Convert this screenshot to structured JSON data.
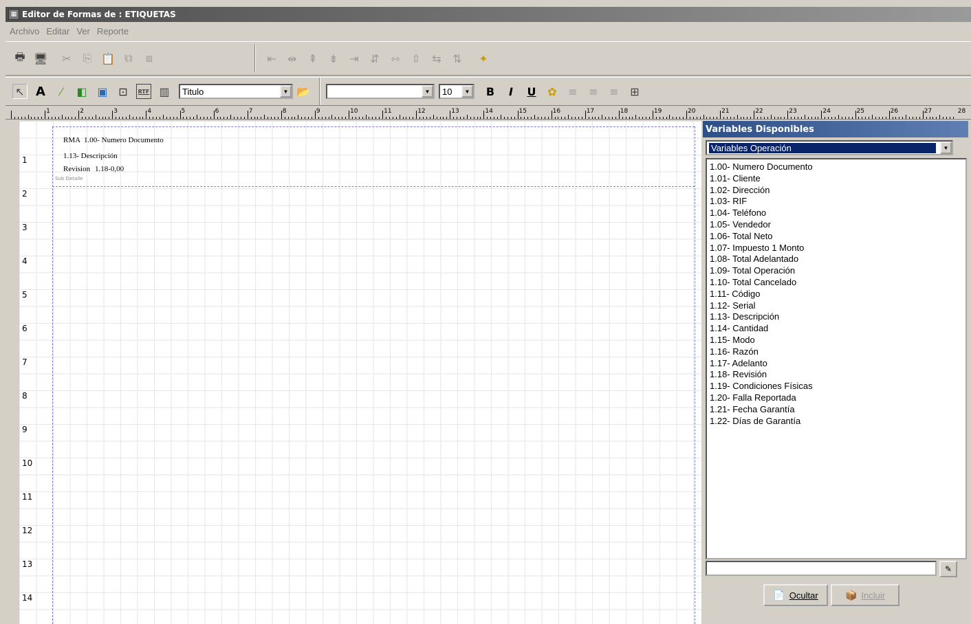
{
  "window": {
    "title": "Editor de Formas de : ETIQUETAS"
  },
  "menu": [
    "Archivo",
    "Editar",
    "Ver",
    "Reporte"
  ],
  "toolbar": {
    "style_combo": "Titulo",
    "font_combo": "",
    "size_combo": "10",
    "bold": "B",
    "italic": "I",
    "underline": "U",
    "rtf": "RTF"
  },
  "ruler": {
    "top": [
      "1",
      "2",
      "3",
      "4",
      "5",
      "6",
      "7",
      "8",
      "9",
      "10",
      "11",
      "12",
      "13",
      "14",
      "15",
      "16",
      "17",
      "18",
      "19",
      "20",
      "21",
      "22",
      "23",
      "24",
      "25",
      "26",
      "27",
      "28"
    ],
    "side": [
      "1",
      "2",
      "3",
      "4",
      "5",
      "6",
      "7",
      "8",
      "9",
      "10",
      "11",
      "12",
      "13",
      "14"
    ]
  },
  "design": {
    "fields": [
      "RMA",
      "1.00- Numero Documento",
      "1.13- Descripción",
      "Revision",
      "1.18-0,00"
    ],
    "band_label": "Sub Detalle"
  },
  "panel": {
    "title": "Variables Disponibles",
    "combo_value": "Variables Operación",
    "items": [
      "1.00- Numero Documento",
      "1.01- Cliente",
      "1.02- Dirección",
      "1.03- RIF",
      "1.04- Teléfono",
      "1.05- Vendedor",
      "1.06- Total Neto",
      "1.07- Impuesto 1 Monto",
      "1.08- Total Adelantado",
      "1.09- Total Operación",
      "1.10- Total Cancelado",
      "1.11- Código",
      "1.12- Serial",
      "1.13- Descripción",
      "1.14- Cantidad",
      "1.15- Modo",
      "1.16- Razón",
      "1.17- Adelanto",
      "1.18- Revisión",
      "1.19- Condiciones Físicas",
      "1.20- Falla Reportada",
      "1.21- Fecha Garantía",
      "1.22- Días de Garantía"
    ],
    "filter_value": "",
    "hide_button": "Ocultar",
    "include_button": "Incluir"
  }
}
